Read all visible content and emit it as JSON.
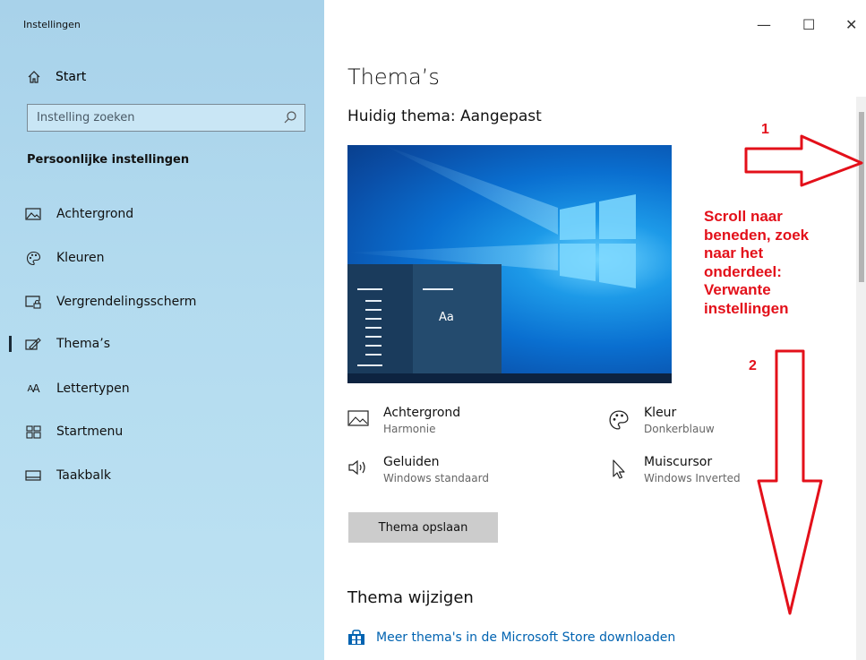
{
  "window": {
    "title": "Instellingen",
    "minimize": "—",
    "maximize": "☐",
    "close": "✕"
  },
  "sidebar": {
    "home_label": "Start",
    "search_placeholder": "Instelling zoeken",
    "section_title": "Persoonlijke instellingen",
    "items": [
      {
        "label": "Achtergrond",
        "icon": "picture-icon"
      },
      {
        "label": "Kleuren",
        "icon": "palette-icon"
      },
      {
        "label": "Vergrendelingsscherm",
        "icon": "lock-screen-icon"
      },
      {
        "label": "Thema’s",
        "icon": "themes-icon",
        "active": true
      },
      {
        "label": "Lettertypen",
        "icon": "font-icon"
      },
      {
        "label": "Startmenu",
        "icon": "start-menu-icon"
      },
      {
        "label": "Taakbalk",
        "icon": "taskbar-icon"
      }
    ]
  },
  "main": {
    "title": "Thema’s",
    "current_theme": "Huidig thema: Aangepast",
    "preview_sample": "Aa",
    "properties": [
      {
        "title": "Achtergrond",
        "value": "Harmonie",
        "icon": "picture-icon"
      },
      {
        "title": "Kleur",
        "value": "Donkerblauw",
        "icon": "palette-icon"
      },
      {
        "title": "Geluiden",
        "value": "Windows standaard",
        "icon": "speaker-icon"
      },
      {
        "title": "Muiscursor",
        "value": "Windows Inverted",
        "icon": "cursor-icon"
      }
    ],
    "save_button": "Thema opslaan",
    "change_title": "Thema wijzigen",
    "store_link": "Meer thema's in de Microsoft Store downloaden"
  },
  "annotation": {
    "label1": "1",
    "label2": "2",
    "text": [
      "Scroll naar",
      "beneden, zoek",
      "naar het",
      "onderdeel:",
      "Verwante",
      "instellingen"
    ],
    "color": "#e3101a"
  },
  "colors": {
    "sidebar": "#b3dbef",
    "accent": "#0063b1",
    "button": "#cccccc"
  }
}
